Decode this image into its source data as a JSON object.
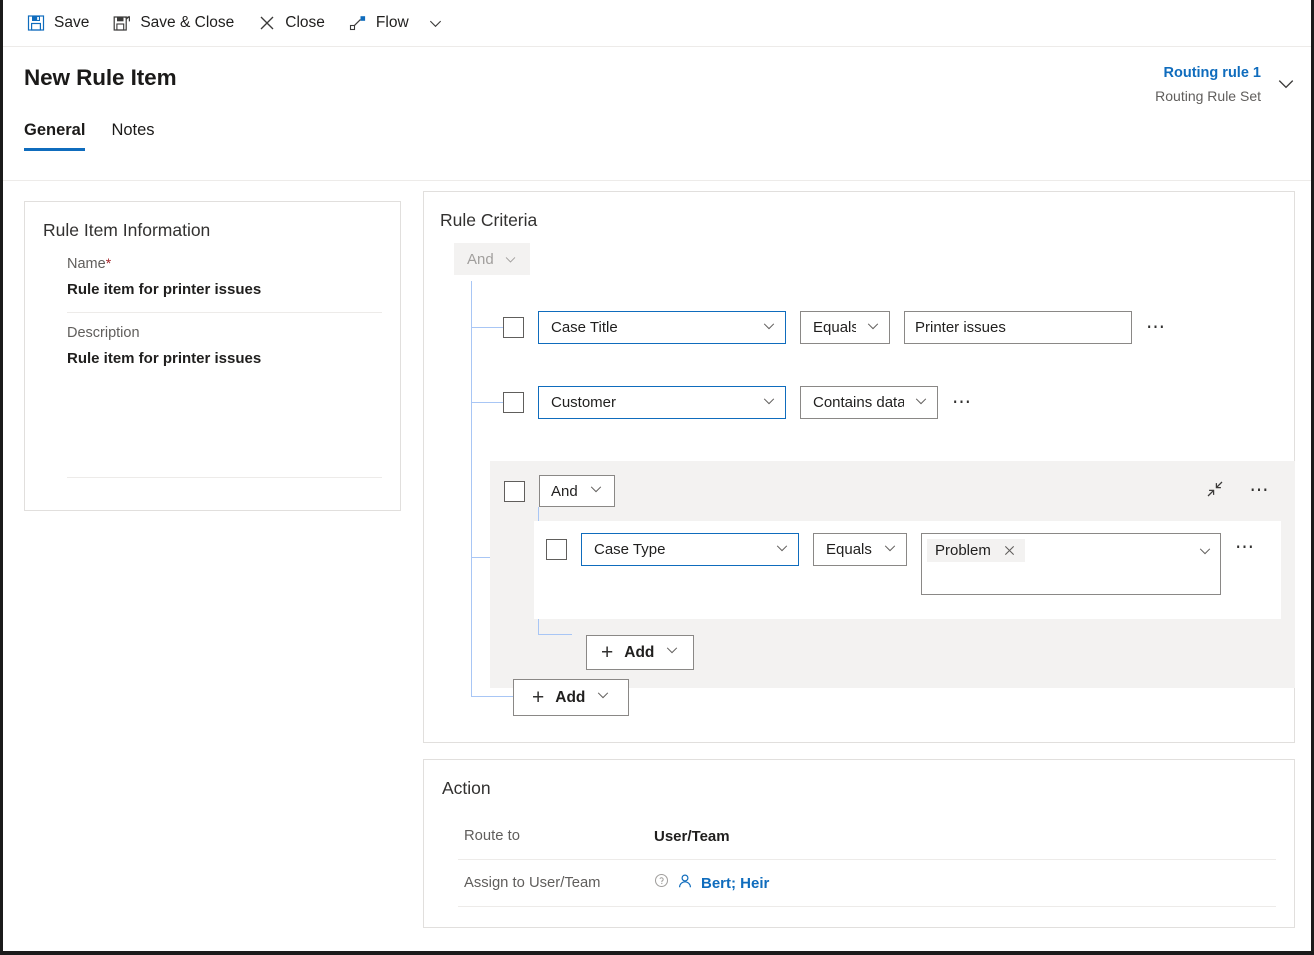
{
  "toolbar": {
    "save": "Save",
    "save_close": "Save & Close",
    "close": "Close",
    "flow": "Flow"
  },
  "header": {
    "title": "New Rule Item",
    "context_name": "Routing rule 1",
    "context_type": "Routing Rule Set",
    "tabs": [
      {
        "label": "General",
        "active": true
      },
      {
        "label": "Notes",
        "active": false
      }
    ]
  },
  "rule_item_information": {
    "title": "Rule Item Information",
    "name_label": "Name",
    "name_required_marker": "*",
    "name_value": "Rule item for printer issues",
    "description_label": "Description",
    "description_value": "Rule item for printer issues"
  },
  "rule_criteria": {
    "title": "Rule Criteria",
    "root_logic": "And",
    "conditions": [
      {
        "attribute": "Case Title",
        "operator": "Equals",
        "value": "Printer issues"
      },
      {
        "attribute": "Customer",
        "operator": "Contains data",
        "value": ""
      }
    ],
    "group": {
      "logic": "And",
      "condition": {
        "attribute": "Case Type",
        "operator": "Equals",
        "value_chip": "Problem"
      },
      "add_label": "Add"
    },
    "add_label": "Add"
  },
  "action": {
    "title": "Action",
    "route_to_label": "Route to",
    "route_to_value": "User/Team",
    "assign_label": "Assign to User/Team",
    "assign_value": "Bert; Heir"
  },
  "colors": {
    "accent": "#0f6cbd",
    "required": "#a4262c",
    "tree_line": "#a8c6f5",
    "group_bg": "#f3f2f1"
  }
}
